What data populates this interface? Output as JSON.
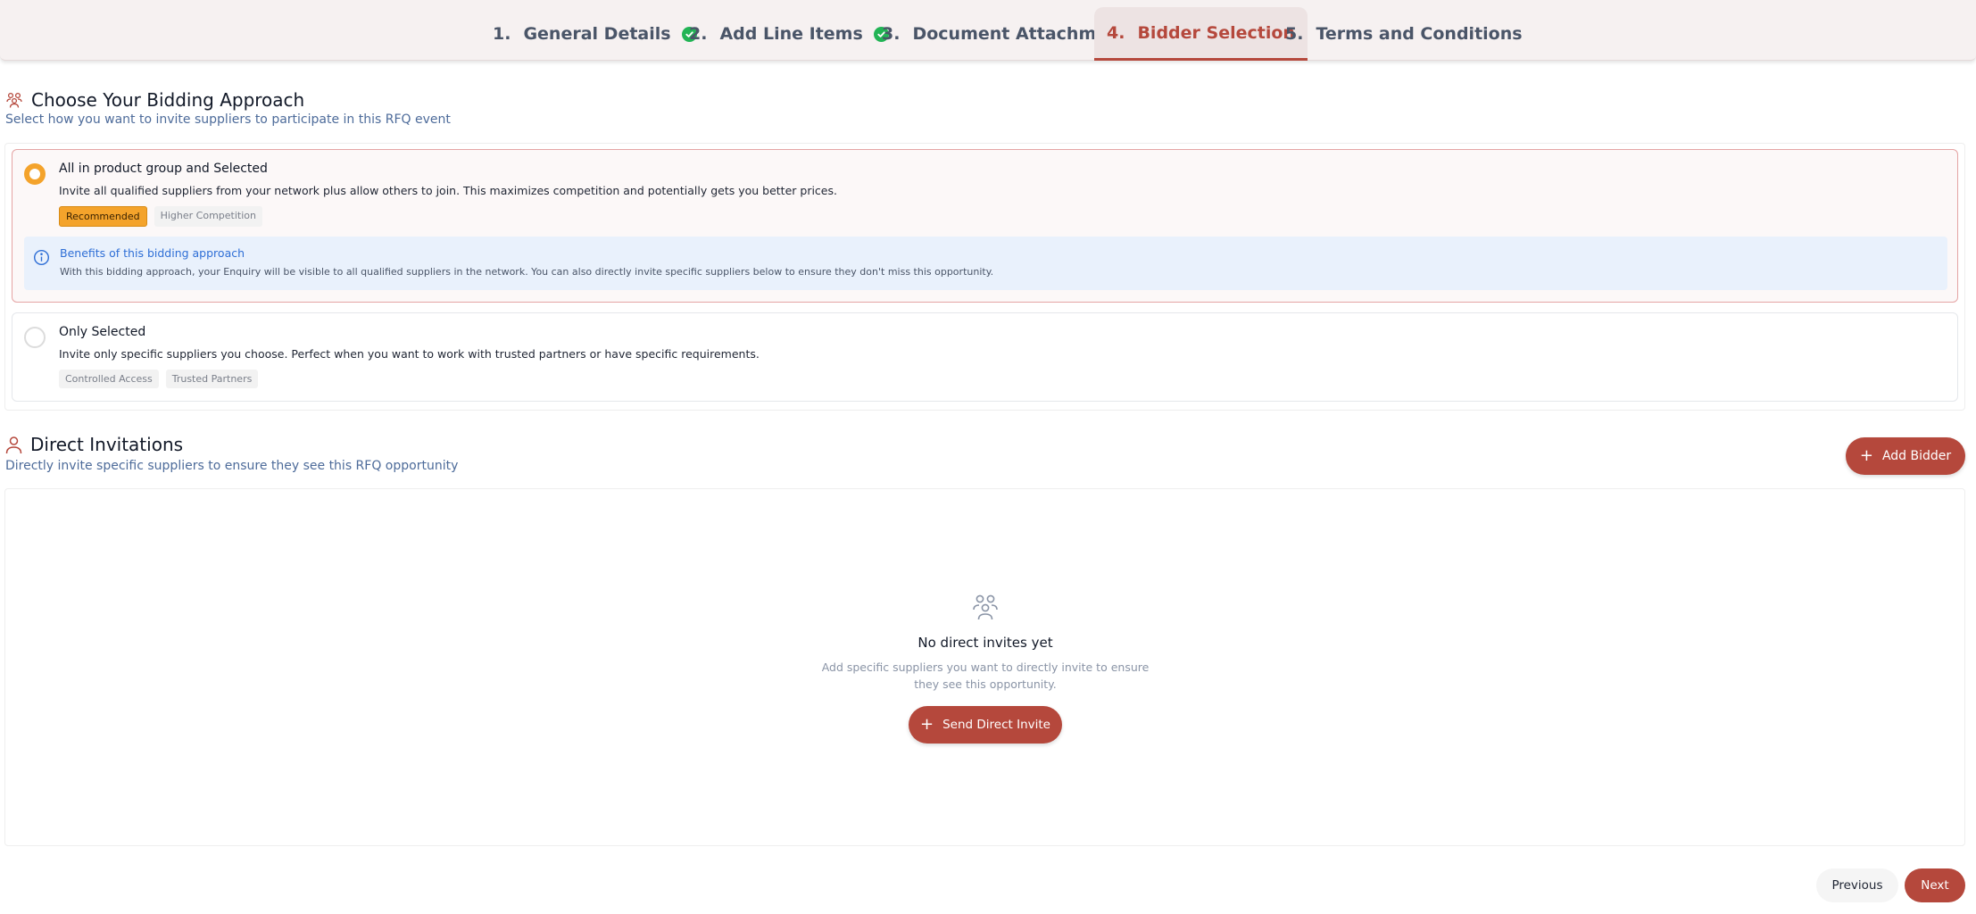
{
  "stepper": {
    "steps": [
      {
        "num": "1.",
        "label": "General Details",
        "completed": true
      },
      {
        "num": "2.",
        "label": "Add Line Items",
        "completed": true
      },
      {
        "num": "3.",
        "label": "Document Attachment",
        "completed": false
      },
      {
        "num": "4.",
        "label": "Bidder Selection",
        "completed": false,
        "active": true
      },
      {
        "num": "5.",
        "label": "Terms and Conditions",
        "completed": false
      }
    ]
  },
  "approach": {
    "title": "Choose Your Bidding Approach",
    "subtitle": "Select how you want to invite suppliers to participate in this RFQ event",
    "options": [
      {
        "title": "All in product group and Selected",
        "description": "Invite all qualified suppliers from your network plus allow others to join. This maximizes competition and potentially gets you better prices.",
        "selected": true,
        "tags": [
          "Recommended",
          "Higher Competition"
        ],
        "benefit_title": "Benefits of this bidding approach",
        "benefit_text": "With this bidding approach, your Enquiry will be visible to all qualified suppliers in the network. You can also directly invite specific suppliers below to ensure they don't miss this opportunity."
      },
      {
        "title": "Only Selected",
        "description": "Invite only specific suppliers you choose. Perfect when you want to work with trusted partners or have specific requirements.",
        "selected": false,
        "tags": [
          "Controlled Access",
          "Trusted Partners"
        ]
      }
    ]
  },
  "invitations": {
    "title": "Direct Invitations",
    "subtitle": "Directly invite specific suppliers to ensure they see this RFQ opportunity",
    "add_button": "Add Bidder",
    "empty_title": "No direct invites yet",
    "empty_text": "Add specific suppliers you want to directly invite to ensure they see this opportunity.",
    "send_button": "Send Direct Invite"
  },
  "footer": {
    "previous": "Previous",
    "next": "Next"
  },
  "colors": {
    "accent": "#b5483c",
    "recommended": "#f4a32b",
    "success": "#22b455",
    "info": "#2f6fd6"
  }
}
